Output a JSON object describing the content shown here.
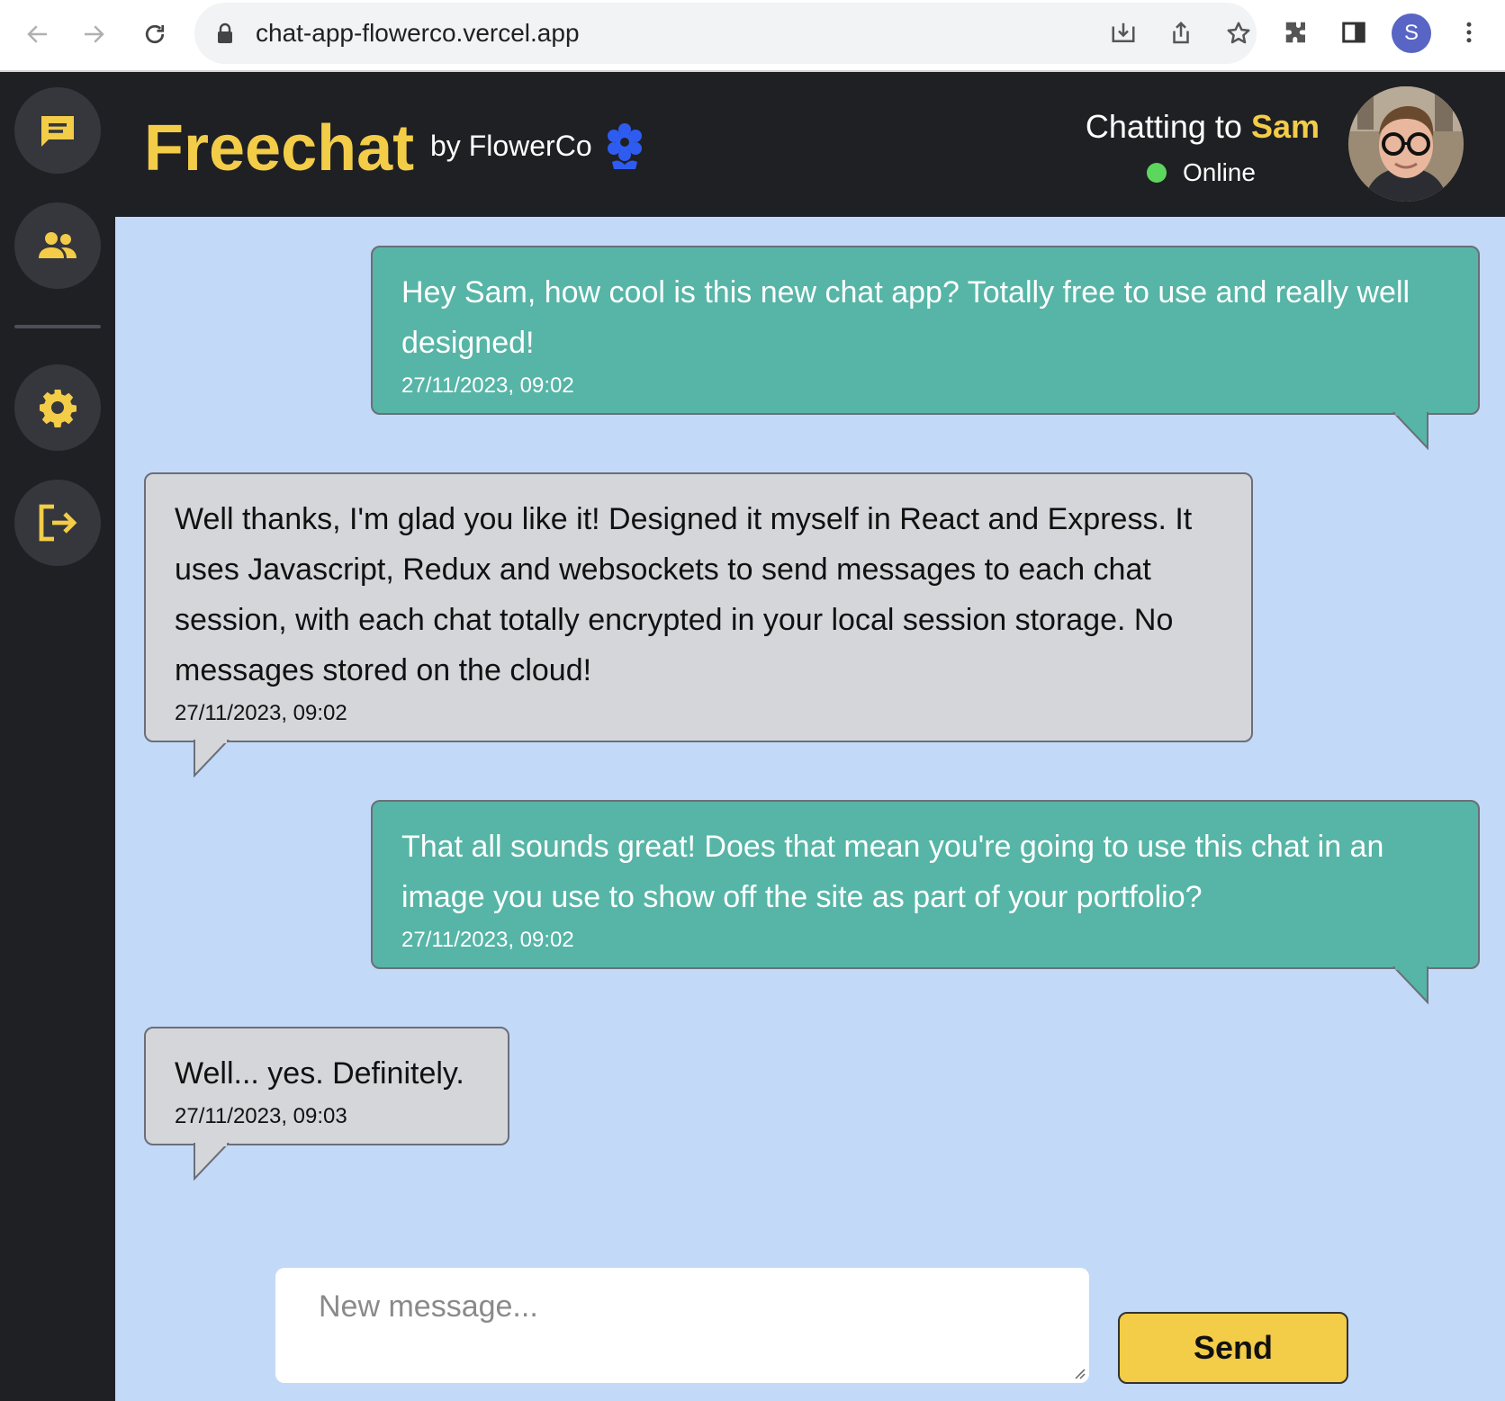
{
  "browser": {
    "url": "chat-app-flowerco.vercel.app",
    "profile_initial": "S"
  },
  "header": {
    "brand": "Freechat",
    "byline": "by FlowerCo",
    "chatting_prefix": "Chatting to ",
    "contact_name": "Sam",
    "status": "Online"
  },
  "messages": [
    {
      "direction": "sent",
      "text": "Hey Sam, how cool is this new chat app? Totally free to use and really well designed!",
      "time": "27/11/2023, 09:02"
    },
    {
      "direction": "received",
      "text": "Well thanks, I'm glad you like it! Designed it myself in React and Express. It uses Javascript, Redux and websockets to send messages to each chat session, with each chat totally encrypted in your local session storage. No messages stored on the cloud!",
      "time": "27/11/2023, 09:02"
    },
    {
      "direction": "sent",
      "text": "That all sounds great! Does that mean you're going to use this chat in an image you use to show off the site as part of your portfolio?",
      "time": "27/11/2023, 09:02"
    },
    {
      "direction": "received",
      "text": "Well... yes. Definitely.",
      "time": "27/11/2023, 09:03"
    }
  ],
  "composer": {
    "placeholder": "New message...",
    "value": "",
    "send_label": "Send"
  },
  "sidebar": {
    "items": [
      {
        "icon": "chat-icon"
      },
      {
        "icon": "users-icon"
      },
      {
        "icon": "gear-icon"
      },
      {
        "icon": "logout-icon"
      }
    ]
  },
  "colors": {
    "accent": "#f3cc48",
    "dark": "#1f2024",
    "chat_bg": "#c3d9f8",
    "sent_bubble": "#56b5a6",
    "received_bubble": "#d4d6da",
    "online": "#5dd65d",
    "flower_icon": "#2f5cf0"
  }
}
